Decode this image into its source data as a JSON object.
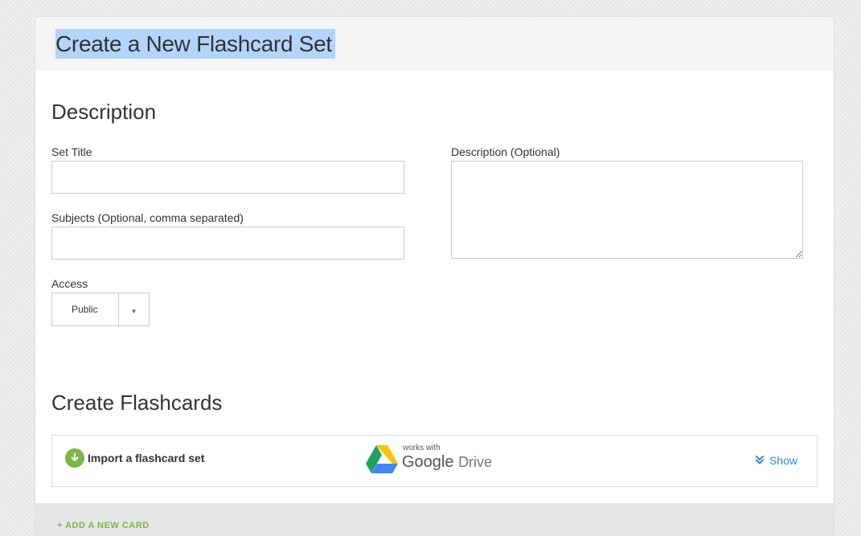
{
  "header": {
    "title": "Create a New Flashcard Set"
  },
  "description_section": {
    "heading": "Description",
    "set_title": {
      "label": "Set Title",
      "value": "",
      "placeholder": ""
    },
    "subjects": {
      "label": "Subjects (Optional, comma separated)",
      "value": "",
      "placeholder": ""
    },
    "description": {
      "label": "Description (Optional)",
      "value": "",
      "placeholder": ""
    },
    "access": {
      "label": "Access",
      "selected": "Public"
    }
  },
  "flashcards_section": {
    "heading": "Create Flashcards",
    "import": {
      "icon": "download-icon",
      "label": "Import a flashcard set",
      "works_with": "works with",
      "google": "Google",
      "drive": "Drive",
      "toggle_icon": "double-chevron-down-icon",
      "toggle_label": "Show"
    },
    "add_card_label": "+ ADD A NEW CARD"
  },
  "colors": {
    "accent_green": "#7ab648",
    "link_blue": "#2a8fd5",
    "selection_highlight": "#b3d4fc"
  }
}
